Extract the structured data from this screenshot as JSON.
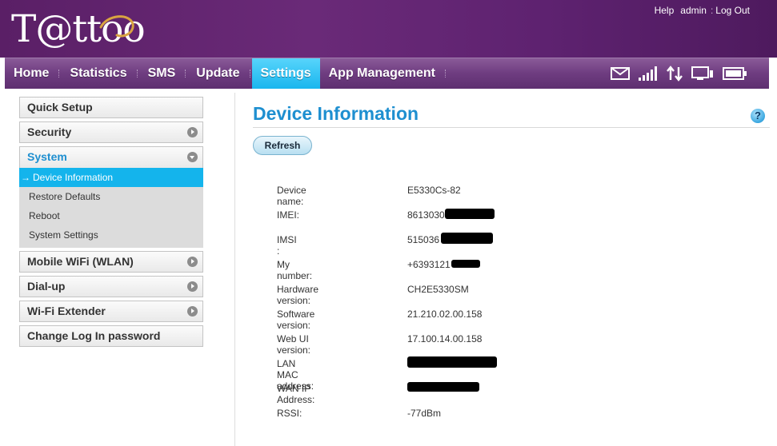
{
  "header": {
    "logo_text": "T@ttoo",
    "links": [
      "Help",
      "admin",
      "Log Out"
    ]
  },
  "nav": {
    "items": [
      "Home",
      "Statistics",
      "SMS",
      "Update",
      "Settings",
      "App Management"
    ],
    "active": "Settings",
    "status_icons": [
      "envelope-icon",
      "signal-strength-icon",
      "data-transfer-icon",
      "device-connected-icon",
      "battery-icon"
    ]
  },
  "sidebar": {
    "quick_setup": "Quick Setup",
    "security": "Security",
    "system": "System",
    "system_items": [
      "Device Information",
      "Restore Defaults",
      "Reboot",
      "System Settings"
    ],
    "active_item": "Device Information",
    "mobile_wifi": "Mobile WiFi (WLAN)",
    "dial_up": "Dial-up",
    "wifi_extender": "Wi-Fi Extender",
    "change_password": "Change Log In password"
  },
  "content": {
    "title": "Device Information",
    "help": "?",
    "refresh": "Refresh",
    "rows": [
      {
        "label": "Device name:",
        "value": "E5330Cs-82"
      },
      {
        "label": "IMEI:",
        "value": "8613030"
      },
      {
        "label": "IMSI :",
        "value": "515036"
      },
      {
        "label": "My number:",
        "value": "+6393121"
      },
      {
        "label": "Hardware version:",
        "value": "CH2E5330SM"
      },
      {
        "label": "Software version:",
        "value": "21.210.02.00.158"
      },
      {
        "label": "Web UI version:",
        "value": "17.100.14.00.158"
      },
      {
        "label": "LAN MAC address:",
        "value": ""
      },
      {
        "label": "WAN IP Address:",
        "value": ""
      },
      {
        "label": "RSSI:",
        "value": "-77dBm"
      }
    ]
  },
  "colors": {
    "header_purple": "#5a1f66",
    "nav_active": "#19b6ee",
    "title_blue": "#1e8fd0"
  }
}
